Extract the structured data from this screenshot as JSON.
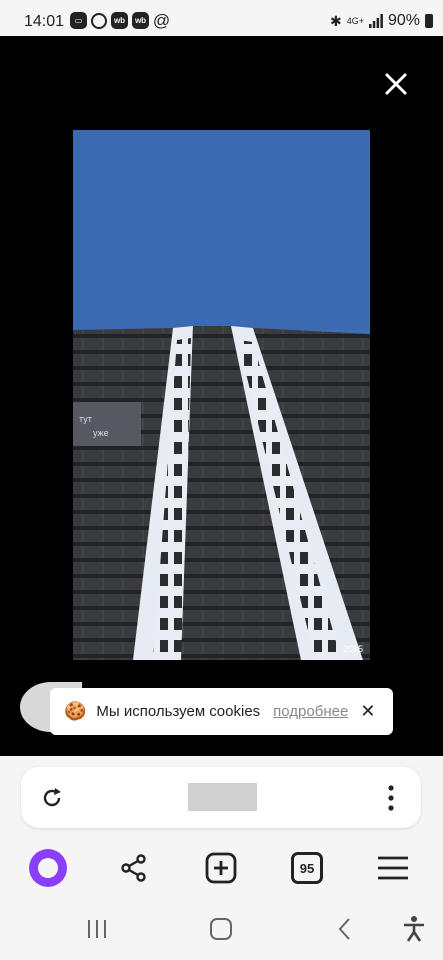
{
  "status_bar": {
    "time": "14:01",
    "network": "4G+",
    "battery": "90%",
    "notification_icons": [
      "wb",
      "wb"
    ]
  },
  "viewer": {
    "photo_watermark": "2015",
    "banner_text": "тут\nуже"
  },
  "cookie_banner": {
    "text": "Мы используем cookies",
    "link": "подробнее"
  },
  "toolbar": {
    "tabs_count": "95"
  },
  "colors": {
    "sky": "#3f6fb6",
    "alice_purple": "#8a3ffc"
  }
}
